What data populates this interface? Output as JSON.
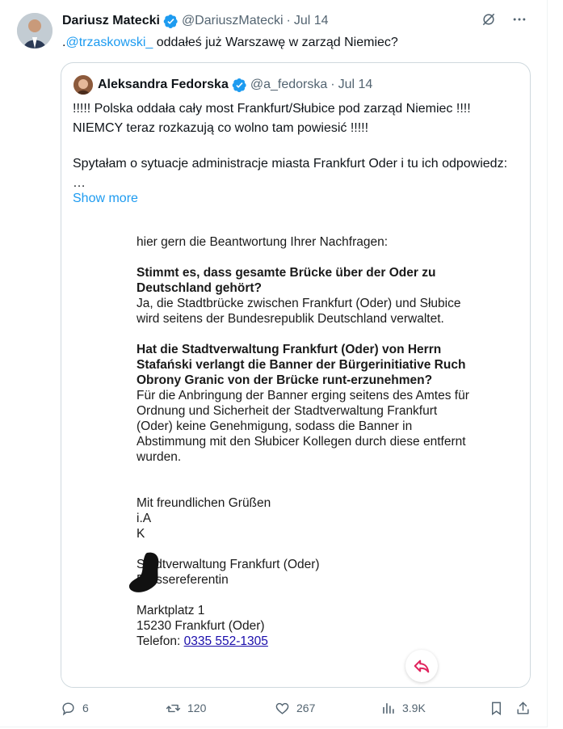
{
  "tweet": {
    "author_name": "Dariusz Matecki",
    "handle": "@DariuszMatecki",
    "separator": "·",
    "date": "Jul 14",
    "text_prefix": ".",
    "mention": "@trzaskowski_",
    "text_rest": " oddałeś już Warszawę w zarząd Niemiec?"
  },
  "quote": {
    "author_name": "Aleksandra Fedorska",
    "handle": "@a_fedorska",
    "separator": "·",
    "date": "Jul 14",
    "line1": "!!!!! Polska oddała cały most Frankfurt/Słubice pod zarząd Niemiec !!!!",
    "line2": "NIEMCY teraz rozkazują co wolno tam powiesić !!!!!",
    "line3": "Spytałam o sytuacje administracje miasta Frankfurt Oder i tu ich odpowiedz: …",
    "show_more": "Show more"
  },
  "document": {
    "intro": "hier gern die Beantwortung Ihrer Nachfragen:",
    "q1": "Stimmt es, dass gesamte Brücke über der Oder zu Deutschland gehört?",
    "a1": "Ja, die Stadtbrücke zwischen Frankfurt (Oder) und Słubice wird seitens der Bundesrepublik Deutschland verwaltet.",
    "q2": "Hat die Stadtverwaltung Frankfurt (Oder) von Herrn Stafański verlangt die Banner der Bürgerinitiative Ruch Obrony Granic von der Brücke runt-erzunehmen?",
    "a2": "Für die Anbringung der Banner erging seitens des Amtes für Ordnung und Sicherheit der Stadtverwaltung Frankfurt (Oder) keine Genehmigung, sodass die Banner in Abstimmung mit den Słubicer Kollegen durch diese entfernt wurden.",
    "closing": "Mit freundlichen Grüßen",
    "sig1": "i.A",
    "sig2": "K",
    "org": "Stadtverwaltung Frankfurt (Oder)",
    "role": "Pressereferentin",
    "street": "Marktplatz 1",
    "city": "15230 Frankfurt (Oder)",
    "phone_label": "Telefon: ",
    "phone": "0335 552-1305"
  },
  "actions": {
    "replies": "6",
    "retweets": "120",
    "likes": "267",
    "views": "3.9K"
  },
  "colors": {
    "accent": "#1d9bf0",
    "text": "#0f1419",
    "secondary": "#536471",
    "border": "#cfd9de"
  }
}
